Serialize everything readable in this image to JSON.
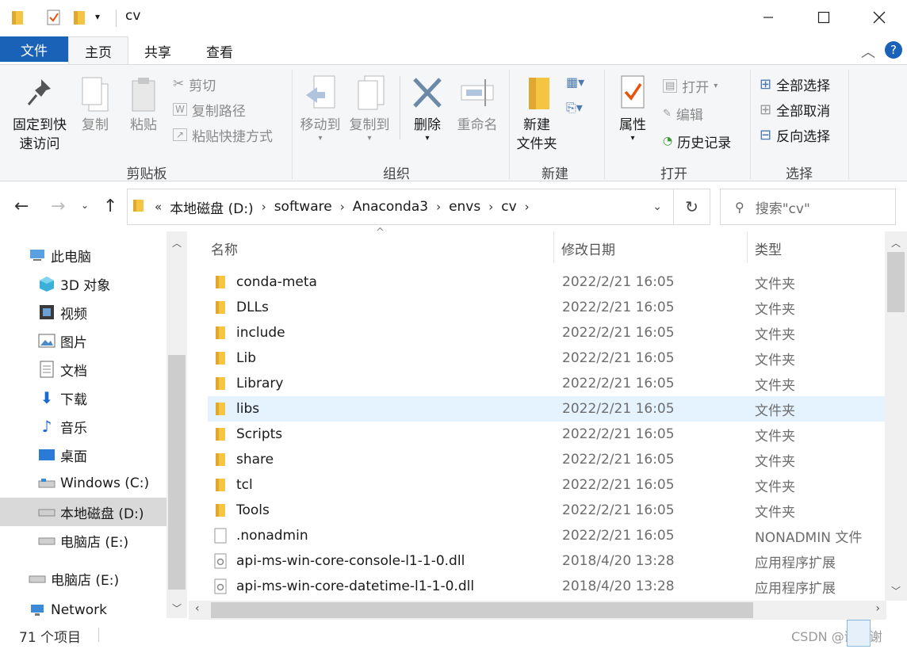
{
  "window": {
    "title": "cv",
    "minimize_icon": "minimize-icon",
    "maximize_icon": "maximize-icon",
    "close_icon": "close-icon"
  },
  "tabs": {
    "file": "文件",
    "home": "主页",
    "share": "共享",
    "view": "查看"
  },
  "ribbon": {
    "clipboard": {
      "pin_line1": "固定到快",
      "pin_line2": "速访问",
      "copy": "复制",
      "paste": "粘贴",
      "cut": "剪切",
      "copy_path": "复制路径",
      "paste_shortcut": "粘贴快捷方式",
      "group": "剪贴板"
    },
    "organize": {
      "move_to": "移动到",
      "copy_to": "复制到",
      "delete": "删除",
      "rename": "重命名",
      "group": "组织"
    },
    "new": {
      "new_folder_line1": "新建",
      "new_folder_line2": "文件夹",
      "group": "新建"
    },
    "open": {
      "properties": "属性",
      "open": "打开",
      "edit": "编辑",
      "history": "历史记录",
      "group": "打开"
    },
    "select": {
      "select_all": "全部选择",
      "select_none": "全部取消",
      "invert": "反向选择",
      "group": "选择"
    }
  },
  "address": {
    "prefix": "«",
    "crumbs": [
      "本地磁盘 (D:)",
      "software",
      "Anaconda3",
      "envs",
      "cv"
    ],
    "search_placeholder": "搜索\"cv\""
  },
  "nav": {
    "items": [
      {
        "label": "此电脑",
        "icon": "computer-icon"
      },
      {
        "label": "3D 对象",
        "icon": "3d-objects-icon"
      },
      {
        "label": "视频",
        "icon": "video-icon"
      },
      {
        "label": "图片",
        "icon": "pictures-icon"
      },
      {
        "label": "文档",
        "icon": "documents-icon"
      },
      {
        "label": "下载",
        "icon": "download-icon"
      },
      {
        "label": "音乐",
        "icon": "music-icon"
      },
      {
        "label": "桌面",
        "icon": "desktop-icon"
      },
      {
        "label": "Windows (C:)",
        "icon": "drive-icon"
      },
      {
        "label": "本地磁盘 (D:)",
        "icon": "drive-icon"
      },
      {
        "label": "电脑店 (E:)",
        "icon": "drive-icon"
      },
      {
        "label": "电脑店 (E:)",
        "icon": "drive-icon"
      },
      {
        "label": "Network",
        "icon": "network-icon"
      }
    ]
  },
  "columns": {
    "name": "名称",
    "date": "修改日期",
    "type": "类型"
  },
  "files": [
    {
      "name": "conda-meta",
      "date": "2022/2/21 16:05",
      "type": "文件夹",
      "kind": "folder"
    },
    {
      "name": "DLLs",
      "date": "2022/2/21 16:05",
      "type": "文件夹",
      "kind": "folder"
    },
    {
      "name": "include",
      "date": "2022/2/21 16:05",
      "type": "文件夹",
      "kind": "folder"
    },
    {
      "name": "Lib",
      "date": "2022/2/21 16:05",
      "type": "文件夹",
      "kind": "folder"
    },
    {
      "name": "Library",
      "date": "2022/2/21 16:05",
      "type": "文件夹",
      "kind": "folder"
    },
    {
      "name": "libs",
      "date": "2022/2/21 16:05",
      "type": "文件夹",
      "kind": "folder"
    },
    {
      "name": "Scripts",
      "date": "2022/2/21 16:05",
      "type": "文件夹",
      "kind": "folder"
    },
    {
      "name": "share",
      "date": "2022/2/21 16:05",
      "type": "文件夹",
      "kind": "folder"
    },
    {
      "name": "tcl",
      "date": "2022/2/21 16:05",
      "type": "文件夹",
      "kind": "folder"
    },
    {
      "name": "Tools",
      "date": "2022/2/21 16:05",
      "type": "文件夹",
      "kind": "folder"
    },
    {
      "name": ".nonadmin",
      "date": "2022/2/21 16:05",
      "type": "NONADMIN 文件",
      "kind": "file"
    },
    {
      "name": "api-ms-win-core-console-l1-1-0.dll",
      "date": "2018/4/20 13:28",
      "type": "应用程序扩展",
      "kind": "dll"
    },
    {
      "name": "api-ms-win-core-datetime-l1-1-0.dll",
      "date": "2018/4/20 13:28",
      "type": "应用程序扩展",
      "kind": "dll"
    }
  ],
  "status": {
    "count": "71 个项目",
    "watermark": "CSDN @谢谢谢"
  },
  "colors": {
    "accent": "#1a62b8",
    "selected": "#cde8ff",
    "hover": "#e5f3ff",
    "folder": "#f4c542"
  }
}
